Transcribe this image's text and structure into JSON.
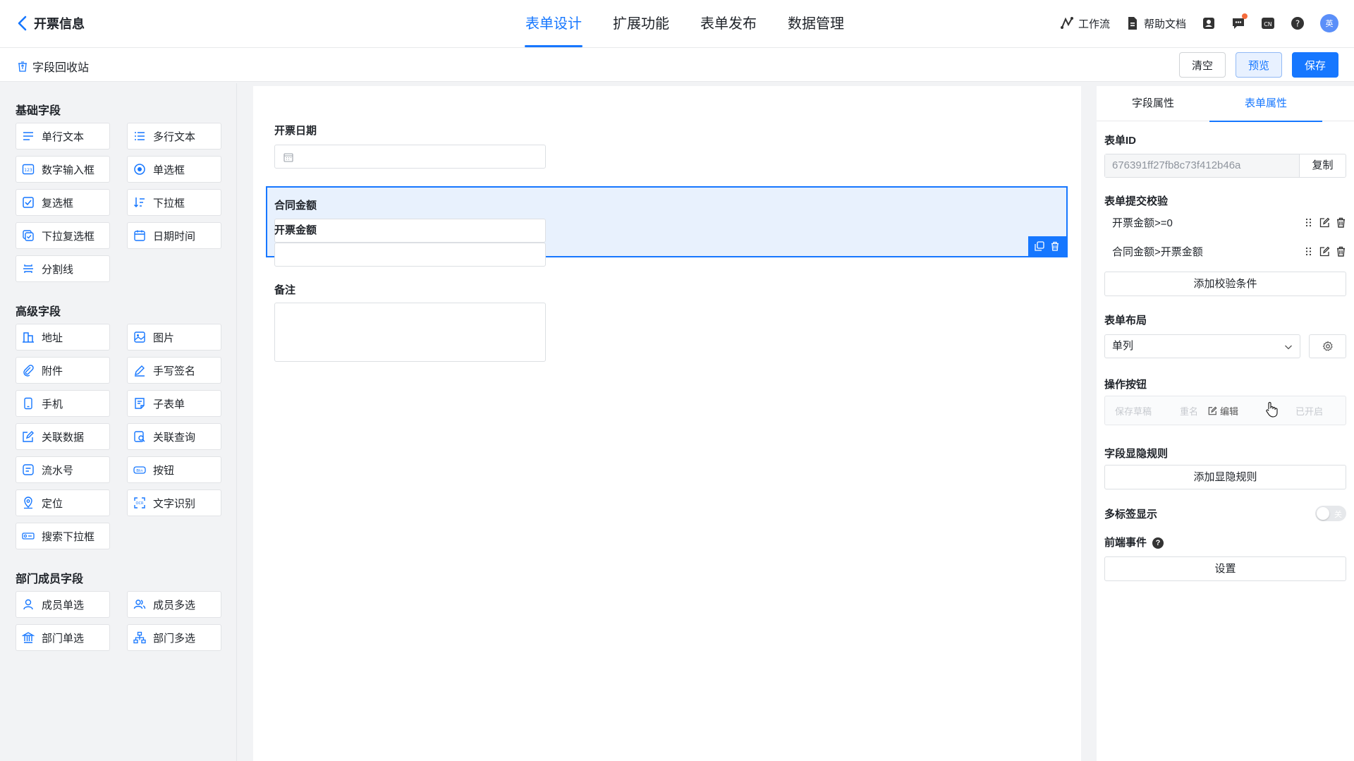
{
  "header": {
    "back_title": "开票信息",
    "tabs": [
      "表单设计",
      "扩展功能",
      "表单发布",
      "数据管理"
    ],
    "active_tab": "表单设计",
    "workflow_label": "工作流",
    "help_label": "帮助文档",
    "lang_label": "CN",
    "help_mark": "?",
    "avatar_text": "英"
  },
  "subbar": {
    "recycle_label": "字段回收站",
    "clear_label": "清空",
    "preview_label": "预览",
    "save_label": "保存"
  },
  "left": {
    "groups": [
      {
        "title": "基础字段",
        "items": [
          "单行文本",
          "多行文本",
          "数字输入框",
          "单选框",
          "复选框",
          "下拉框",
          "下拉复选框",
          "日期时间",
          "分割线"
        ]
      },
      {
        "title": "高级字段",
        "items": [
          "地址",
          "图片",
          "附件",
          "手写签名",
          "手机",
          "子表单",
          "关联数据",
          "关联查询",
          "流水号",
          "按钮",
          "定位",
          "文字识别",
          "搜索下拉框"
        ]
      },
      {
        "title": "部门成员字段",
        "items": [
          "成员单选",
          "成员多选",
          "部门单选",
          "部门多选"
        ]
      }
    ]
  },
  "canvas": {
    "fields": [
      {
        "label": "开票日期"
      },
      {
        "label": "合同金额"
      },
      {
        "label": "开票金额"
      },
      {
        "label": "备注"
      }
    ]
  },
  "right": {
    "tabs": [
      "字段属性",
      "表单属性"
    ],
    "active_tab": "表单属性",
    "form_id_label": "表单ID",
    "form_id_value": "676391ff27fb8c73f412b46a",
    "copy_label": "复制",
    "validation_label": "表单提交校验",
    "rules": [
      "开票金额>=0",
      "合同金额>开票金额"
    ],
    "add_rule_label": "添加校验条件",
    "layout_label": "表单布局",
    "layout_value": "单列",
    "ops_label": "操作按钮",
    "ops_items": [
      "保存草稿",
      "重名",
      "编辑",
      "已开启"
    ],
    "visibility_label": "字段显隐规则",
    "add_visibility_label": "添加显隐规则",
    "multitag_label": "多标签显示",
    "toggle_text": "关",
    "frontend_label": "前端事件",
    "frontend_mark": "?",
    "settings_label": "设置"
  },
  "colors": {
    "accent": "#1677ff",
    "selected_bg": "#e8f1fd"
  }
}
